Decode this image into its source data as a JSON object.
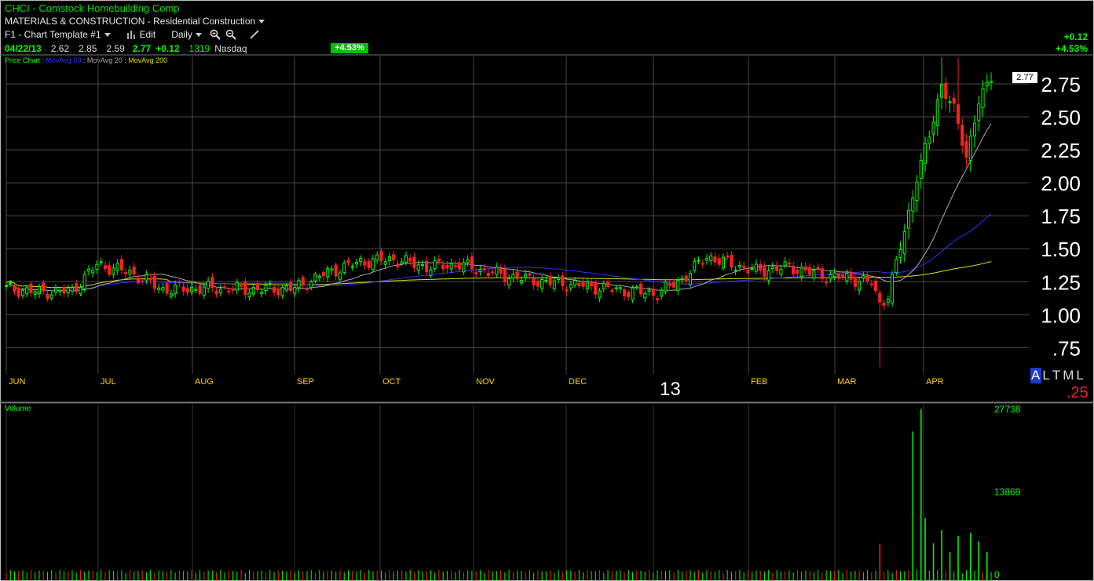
{
  "header": {
    "title": "CHCI - Comstock Homebuilding Comp",
    "industry": "MATERIALS & CONSTRUCTION - Residential Construction",
    "template": "F1 - Chart Template #1",
    "edit": "Edit",
    "period": "Daily"
  },
  "quote": {
    "date": "04/22/13",
    "open": "2.62",
    "high": "2.85",
    "low": "2.59",
    "close": "2.77",
    "change": "+0.12",
    "volume": "1319",
    "exchange": "Nasdaq",
    "pct": "+4.53%"
  },
  "right_panel": {
    "change": "+0.12",
    "pct": "+4.53%",
    "last": "2.77"
  },
  "legend": {
    "price": "Price Chart",
    "ma50": "MovAvg 50",
    "ma20": "MovAvg 20",
    "ma200": "MovAvg 200"
  },
  "ranges": [
    "A",
    "L",
    "T",
    "M",
    "L"
  ],
  "decimal": ".25",
  "year_marker": "13",
  "volume_label": "Volume",
  "colors": {
    "up": "#00ff00",
    "down": "#ff2020",
    "ma50": "#3030ff",
    "ma20": "#aaaaaa",
    "ma200": "#e0e000",
    "grid": "#4a4a4a",
    "axis": "#ffffff",
    "month": "#ffd200"
  },
  "chart_data": {
    "type": "candlestick",
    "x_labels": [
      "JUN",
      "JUL",
      "AUG",
      "SEP",
      "OCT",
      "NOV",
      "DEC",
      "13",
      "FEB",
      "MAR",
      "APR"
    ],
    "y_ticks": [
      "2.75",
      "2.50",
      "2.25",
      "2.00",
      "1.75",
      "1.50",
      "1.25",
      "1.00",
      ".75"
    ],
    "ylim": [
      0.55,
      2.97
    ],
    "volume_ticks": [
      "27738",
      "13869",
      "0"
    ],
    "volume_max": 27738,
    "anchors": [
      {
        "day": 0,
        "c": 1.2
      },
      {
        "day": 8,
        "c": 1.17
      },
      {
        "day": 16,
        "c": 1.18
      },
      {
        "day": 22,
        "c": 1.38
      },
      {
        "day": 30,
        "c": 1.32
      },
      {
        "day": 38,
        "c": 1.19
      },
      {
        "day": 50,
        "c": 1.2
      },
      {
        "day": 60,
        "c": 1.19
      },
      {
        "day": 70,
        "c": 1.2
      },
      {
        "day": 78,
        "c": 1.32
      },
      {
        "day": 86,
        "c": 1.4
      },
      {
        "day": 94,
        "c": 1.42
      },
      {
        "day": 102,
        "c": 1.36
      },
      {
        "day": 110,
        "c": 1.38
      },
      {
        "day": 120,
        "c": 1.3
      },
      {
        "day": 130,
        "c": 1.25
      },
      {
        "day": 140,
        "c": 1.22
      },
      {
        "day": 150,
        "c": 1.18
      },
      {
        "day": 158,
        "c": 1.16
      },
      {
        "day": 164,
        "c": 1.27
      },
      {
        "day": 170,
        "c": 1.44
      },
      {
        "day": 176,
        "c": 1.38
      },
      {
        "day": 182,
        "c": 1.33
      },
      {
        "day": 190,
        "c": 1.36
      },
      {
        "day": 198,
        "c": 1.3
      },
      {
        "day": 206,
        "c": 1.27
      },
      {
        "day": 210,
        "c": 1.24
      },
      {
        "day": 212,
        "c": 1.08
      },
      {
        "day": 214,
        "c": 1.15
      },
      {
        "day": 218,
        "c": 1.63
      },
      {
        "day": 221,
        "c": 2.05
      },
      {
        "day": 224,
        "c": 2.35
      },
      {
        "day": 227,
        "c": 2.75
      },
      {
        "day": 230,
        "c": 2.55
      },
      {
        "day": 233,
        "c": 2.2
      },
      {
        "day": 236,
        "c": 2.62
      },
      {
        "day": 239,
        "c": 2.77
      }
    ],
    "volume_bars": [
      {
        "day": 212,
        "v": 5200,
        "up": false
      },
      {
        "day": 220,
        "v": 24000,
        "up": true
      },
      {
        "day": 222,
        "v": 27738,
        "up": true
      },
      {
        "day": 223,
        "v": 9500,
        "up": true
      },
      {
        "day": 225,
        "v": 5300,
        "up": true
      },
      {
        "day": 227,
        "v": 7500,
        "up": true
      },
      {
        "day": 229,
        "v": 3800,
        "up": true
      },
      {
        "day": 231,
        "v": 6500,
        "up": true
      },
      {
        "day": 234,
        "v": 7000,
        "up": true
      },
      {
        "day": 236,
        "v": 5600,
        "up": true
      },
      {
        "day": 238,
        "v": 3800,
        "up": true
      }
    ]
  }
}
